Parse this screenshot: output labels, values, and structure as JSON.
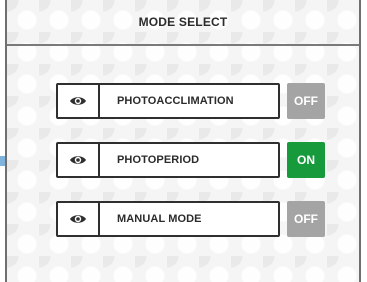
{
  "header": {
    "title": "MODE SELECT"
  },
  "modes": [
    {
      "label": "PHOTOACCLIMATION",
      "icon": "eye-icon",
      "state": "OFF",
      "state_color": "#a4a4a4"
    },
    {
      "label": "PHOTOPERIOD",
      "icon": "eye-icon",
      "state": "ON",
      "state_color": "#169a3c"
    },
    {
      "label": "MANUAL MODE",
      "icon": "eye-icon",
      "state": "OFF",
      "state_color": "#a4a4a4"
    }
  ],
  "indicator": {
    "icon": "arrow-right-icon",
    "color": "#7fb3dc",
    "points_to": "PHOTOPERIOD"
  }
}
